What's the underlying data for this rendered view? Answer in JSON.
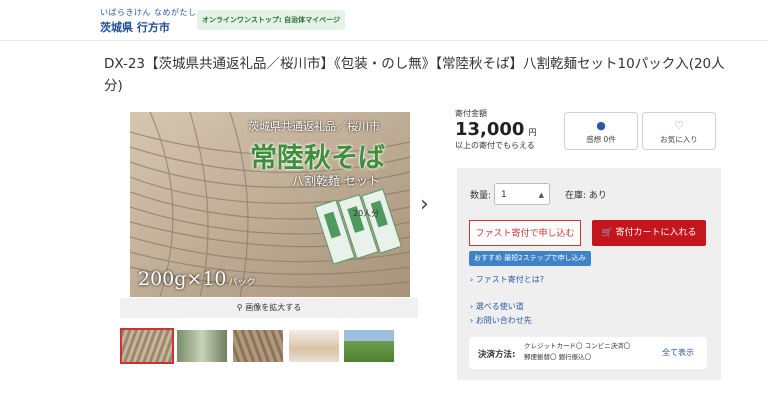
{
  "header": {
    "city_kana": "いばらきけん なめがたし",
    "city_name": "茨城県 行方市",
    "onestop_label": "オンラインワンストップ: 自治体マイページ"
  },
  "product": {
    "title": "DX-23【茨城県共通返礼品／桜川市】《包装・のし無》【常陸秋そば】八割乾麺セット10パック入(20人分)"
  },
  "image": {
    "overlay_top": "茨城県共通返礼品／桜川市",
    "overlay_main": "常陸秋そば",
    "overlay_sub": "八割乾麺 セット",
    "overlay_servings": "20人分",
    "overlay_bottom": "200g×10",
    "overlay_bottom_unit": "パック",
    "zoom_label": "画像を拡大する"
  },
  "price": {
    "label": "寄付金額",
    "amount": "13,000",
    "unit": "円",
    "note": "以上の寄付でもらえる"
  },
  "actions": {
    "reviews_label": "感想 0件",
    "favorite_label": "お気に入り"
  },
  "order": {
    "qty_label": "数量:",
    "qty_value": "1",
    "stock_label": "在庫: あり",
    "fast_button": "ファスト寄付で申し込む",
    "cart_button": "寄付カートに入れる",
    "recommend_badge": "おすすめ 最短2ステップで申し込み",
    "fast_help_link": "ファスト寄付とは?",
    "usage_link": "選べる使い道",
    "contact_link": "お問い合わせ先"
  },
  "payment": {
    "label": "決済方法:",
    "methods_line1": "クレジットカード〇  コンビニ決済〇",
    "methods_line2": "郵便振替〇  銀行振込〇",
    "show_all": "全て表示"
  },
  "colors": {
    "accent_red": "#c4161c",
    "link_blue": "#2a5aa6",
    "badge_blue": "#3f83c6"
  }
}
